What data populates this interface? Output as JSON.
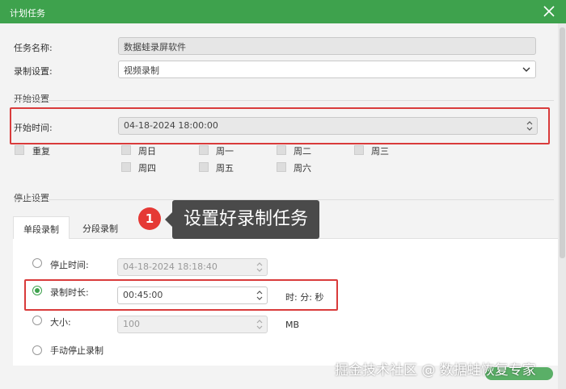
{
  "window": {
    "title": "计划任务"
  },
  "task": {
    "name_label": "任务名称:",
    "name_value": "数据蛙录屏软件"
  },
  "record_setting": {
    "label": "录制设置:",
    "value": "视频录制"
  },
  "start": {
    "section_title": "开始设置",
    "time_label": "开始时间:",
    "time_value": "04-18-2024 18:00:00",
    "repeat_label": "重复",
    "days": [
      "周日",
      "周一",
      "周二",
      "周三",
      "周四",
      "周五",
      "周六"
    ]
  },
  "stop": {
    "section_title": "停止设置",
    "tabs": [
      "单段录制",
      "分段录制"
    ],
    "stop_time_label": "停止时间:",
    "stop_time_value": "04-18-2024 18:18:40",
    "duration_label": "录制时长:",
    "duration_value": "00:45:00",
    "duration_units": "时: 分: 秒",
    "size_label": "大小:",
    "size_value": "100",
    "size_unit": "MB",
    "manual_label": "手动停止录制"
  },
  "annotation": {
    "badge": "1",
    "text": "设置好录制任务"
  },
  "watermark": "掘金技术社区 @ 数据蛙恢复专家",
  "colors": {
    "accent": "#3ea24d",
    "highlight": "#d93b3b",
    "badge": "#e53935"
  }
}
